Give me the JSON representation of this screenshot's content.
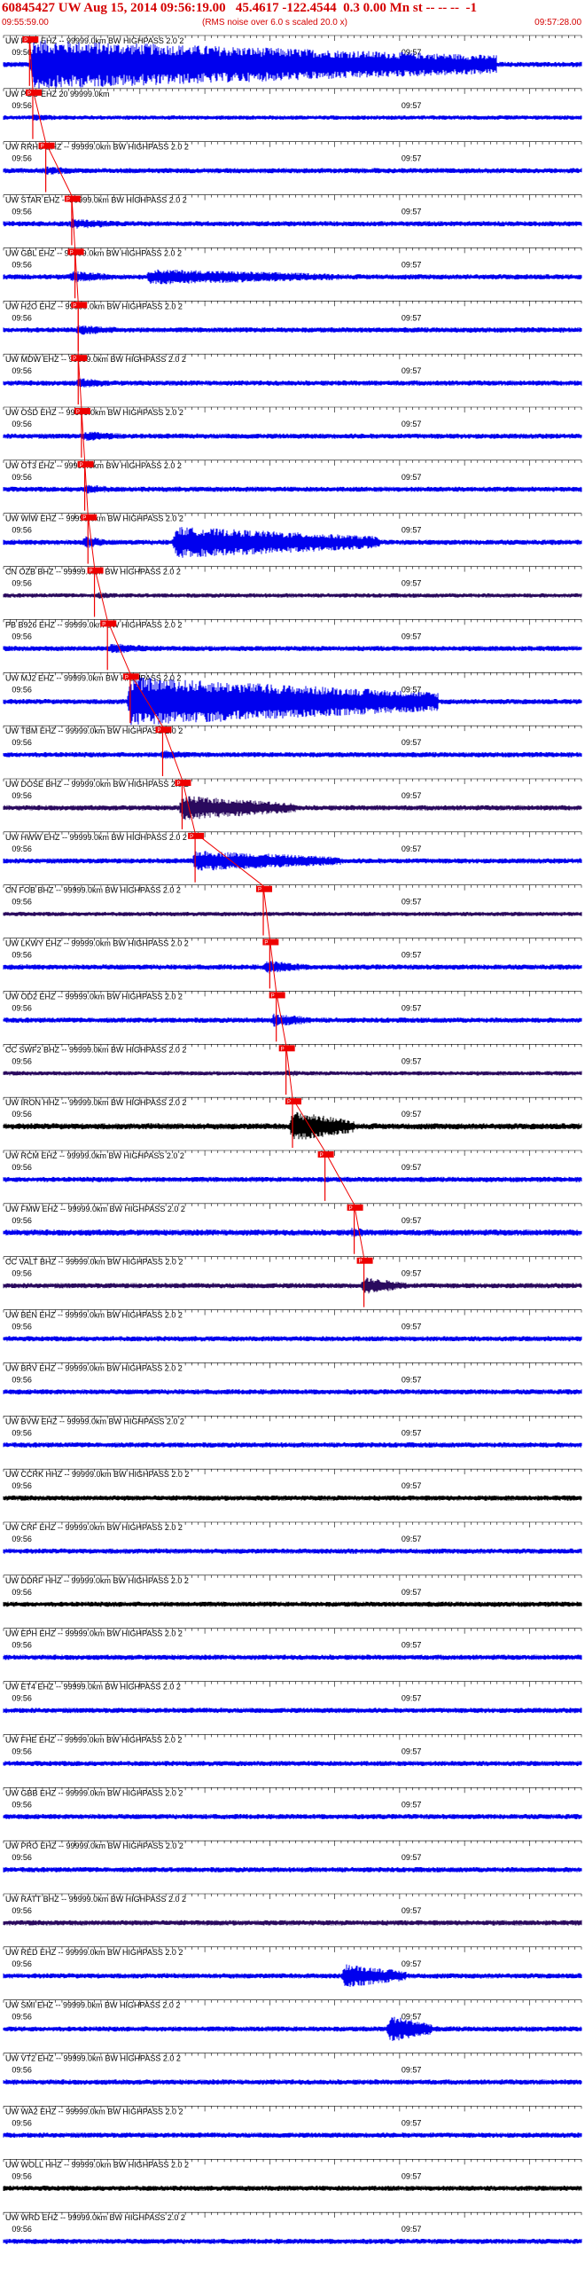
{
  "header": {
    "title": "60845427 UW Aug 15, 2014 09:56:19.00   45.4617 -122.4544  0.3 0.00 Mn st -- -- --  -1",
    "start_time": "09:55:59.00",
    "subtitle": "(RMS noise over 6.0 s scaled 20.0 x)",
    "end_time": "09:57:28.00"
  },
  "colors": {
    "trace_blue": "#0000ee",
    "trace_black": "#000000",
    "trace_purple": "#2a0a5e",
    "pick_red": "#ee0000",
    "header_red": "#d40000",
    "axis": "#000000"
  },
  "chart_data": {
    "type": "line",
    "title": "60845427 UW Aug 15, 2014 09:56:19.00   45.4617 -122.4544  0.3 0.00 Mn st -- -- --  -1",
    "x_range": [
      "09:55:59.00",
      "09:57:28.00"
    ],
    "x_range_seconds": [
      0,
      89
    ],
    "minute_tick_labels": [
      "09:56",
      "09:57"
    ],
    "minute_tick_seconds": [
      1,
      61
    ],
    "traces": [
      {
        "label": "UW PGO EHZ -- 99999.0km BW  HIGHPASS  2.0  2",
        "color": "blue",
        "amp": 3,
        "event": [
          [
            4,
            76,
            28
          ]
        ],
        "pick": 4,
        "pick_label": "P"
      },
      {
        "label": "UW PGO EHZ 20 99999.0km",
        "color": "blue",
        "amp": 2.5,
        "event": [
          [
            4,
            12,
            4
          ]
        ],
        "pick": 4.5,
        "pick_label": "P"
      },
      {
        "label": "UW RRHS EHZ -- 99999.0km BW  HIGHPASS  2.0  2",
        "color": "blue",
        "amp": 3,
        "event": [
          [
            6,
            14,
            5
          ]
        ],
        "pick": 6.5,
        "pick_label": "P"
      },
      {
        "label": "UW STAR EHZ -- 99999.0km BW  HIGHPASS  2.0  2",
        "color": "blue",
        "amp": 3,
        "event": [
          [
            10,
            20,
            6
          ]
        ],
        "pick": 10.5,
        "pick_label": "P"
      },
      {
        "label": "UW GBL EHZ -- 99999.0km BW  HIGHPASS  2.0  2",
        "color": "blue",
        "amp": 3,
        "event": [
          [
            10,
            18,
            7
          ],
          [
            22,
            52,
            9
          ]
        ],
        "pick": 11,
        "pick_label": "P"
      },
      {
        "label": "UW H2O EHZ -- 99999.0km BW  HIGHPASS  2.0  2",
        "color": "blue",
        "amp": 3,
        "event": [
          [
            11,
            20,
            6
          ]
        ],
        "pick": 11.5,
        "pick_label": "P"
      },
      {
        "label": "UW MDW EHZ -- 99999.0km BW  HIGHPASS  2.0  2",
        "color": "blue",
        "amp": 3,
        "event": [
          [
            11,
            18,
            6
          ]
        ],
        "pick": 11.5,
        "pick_label": "P"
      },
      {
        "label": "UW OSD EHZ -- 99999.0km BW  HIGHPASS  2.0  2",
        "color": "blue",
        "amp": 3,
        "event": [
          [
            12,
            20,
            6
          ]
        ],
        "pick": 12,
        "pick_label": "P"
      },
      {
        "label": "UW OT3 EHZ -- 99999.0km BW  HIGHPASS  2.0  2",
        "color": "blue",
        "amp": 3,
        "event": [
          [
            12,
            18,
            6
          ]
        ],
        "pick": 12.5,
        "pick_label": "P"
      },
      {
        "label": "UW WIW EHZ -- 99999.0km BW  HIGHPASS  2.0  2",
        "color": "blue",
        "amp": 3,
        "event": [
          [
            12,
            16,
            8
          ],
          [
            26,
            58,
            18
          ]
        ],
        "pick": 13,
        "pick_label": "P"
      },
      {
        "label": "CN OZB BHZ -- 99999.0km BW  HIGHPASS  2.0  2",
        "color": "purple",
        "amp": 2.5,
        "event": [
          [
            14,
            20,
            4
          ]
        ],
        "pick": 14,
        "pick_label": "P"
      },
      {
        "label": "PB B926 EHZ -- 99999.0km BW  HIGHPASS  2.0  2",
        "color": "blue",
        "amp": 3,
        "event": [
          [
            16,
            26,
            6
          ]
        ],
        "pick": 16,
        "pick_label": "P"
      },
      {
        "label": "UW MJ2 EHZ -- 99999.0km BW  HIGHPASS  2.0  2",
        "color": "blue",
        "amp": 3,
        "event": [
          [
            19,
            67,
            28
          ]
        ],
        "pick": 19.5,
        "pick_label": "P"
      },
      {
        "label": "UW TBM EHZ -- 99999.0km BW  HIGHPASS  2.0  2",
        "color": "blue",
        "amp": 3,
        "event": [
          [
            24,
            30,
            6
          ]
        ],
        "pick": 24.5,
        "pick_label": "P"
      },
      {
        "label": "UW DOSE BHZ -- 99999.0km BW  HIGHPASS  2.0  2",
        "color": "purple",
        "amp": 3,
        "event": [
          [
            27,
            45,
            14
          ]
        ],
        "pick": 27.5,
        "pick_label": "P"
      },
      {
        "label": "UW HWW EHZ -- 99999.0km BW  HIGHPASS  2.0  2",
        "color": "blue",
        "amp": 3,
        "event": [
          [
            29,
            52,
            12
          ]
        ],
        "pick": 29.5,
        "pick_label": "P"
      },
      {
        "label": "CN FOB BHZ -- 99999.0km BW  HIGHPASS  2.0  2",
        "color": "purple",
        "amp": 2.5,
        "event": [
          [
            40,
            45,
            3
          ]
        ],
        "pick": 40,
        "pick_label": "P"
      },
      {
        "label": "UW LKWY EHZ -- 99999.0km BW  HIGHPASS  2.0  2",
        "color": "blue",
        "amp": 3,
        "event": [
          [
            40,
            47,
            8
          ]
        ],
        "pick": 41,
        "pick_label": "P"
      },
      {
        "label": "UW OD2 EHZ -- 99999.0km BW  HIGHPASS  2.0  2",
        "color": "blue",
        "amp": 3,
        "event": [
          [
            41,
            48,
            8
          ]
        ],
        "pick": 42,
        "pick_label": "P"
      },
      {
        "label": "CC SWF2 BHZ -- 99999.0km BW  HIGHPASS  2.0  2",
        "color": "purple",
        "amp": 2.5,
        "event": [
          [
            43,
            48,
            4
          ]
        ],
        "pick": 43.5,
        "pick_label": "P"
      },
      {
        "label": "UW IRON HHZ -- 99999.0km BW  HIGHPASS  2.0  2",
        "color": "black",
        "amp": 3.5,
        "event": [
          [
            44,
            54,
            18
          ]
        ],
        "pick": 44.5,
        "pick_label": "P"
      },
      {
        "label": "UW RCM EHZ -- 99999.0km BW  HIGHPASS  2.0  2",
        "color": "blue",
        "amp": 3,
        "event": [
          [
            49,
            53,
            4
          ]
        ],
        "pick": 49.5,
        "pick_label": "P"
      },
      {
        "label": "UW FMW EHZ -- 99999.0km BW  HIGHPASS  2.0  2",
        "color": "blue",
        "amp": 3.5,
        "event": [
          [
            53,
            58,
            6
          ]
        ],
        "pick": 54,
        "pick_label": "P"
      },
      {
        "label": "CC VALT BHZ -- 99999.0km BW  HIGHPASS  2.0  2",
        "color": "purple",
        "amp": 3,
        "event": [
          [
            55,
            62,
            10
          ]
        ],
        "pick": 55.5,
        "pick_label": "P"
      },
      {
        "label": "UW BEN EHZ -- 99999.0km BW  HIGHPASS  2.0  2",
        "color": "blue",
        "amp": 3,
        "event": [],
        "pick": null,
        "pick_label": ""
      },
      {
        "label": "UW BRV EHZ -- 99999.0km BW  HIGHPASS  2.0  2",
        "color": "blue",
        "amp": 3,
        "event": [],
        "pick": null,
        "pick_label": ""
      },
      {
        "label": "UW BVW EHZ -- 99999.0km BW  HIGHPASS  2.0  2",
        "color": "blue",
        "amp": 3,
        "event": [],
        "pick": null,
        "pick_label": ""
      },
      {
        "label": "UW CCRK HHZ -- 99999.0km BW  HIGHPASS  2.0  2",
        "color": "black",
        "amp": 3,
        "event": [],
        "pick": null,
        "pick_label": ""
      },
      {
        "label": "UW CRF EHZ -- 99999.0km BW  HIGHPASS  2.0  2",
        "color": "blue",
        "amp": 3,
        "event": [],
        "pick": null,
        "pick_label": ""
      },
      {
        "label": "UW DDRF HHZ -- 99999.0km BW  HIGHPASS  2.0  2",
        "color": "black",
        "amp": 3,
        "event": [],
        "pick": null,
        "pick_label": ""
      },
      {
        "label": "UW EPH EHZ -- 99999.0km BW  HIGHPASS  2.0  2",
        "color": "blue",
        "amp": 3,
        "event": [],
        "pick": null,
        "pick_label": ""
      },
      {
        "label": "UW ET4 EHZ -- 99999.0km BW  HIGHPASS  2.0  2",
        "color": "blue",
        "amp": 3,
        "event": [],
        "pick": null,
        "pick_label": ""
      },
      {
        "label": "UW FHE EHZ -- 99999.0km BW  HIGHPASS  2.0  2",
        "color": "blue",
        "amp": 3,
        "event": [],
        "pick": null,
        "pick_label": ""
      },
      {
        "label": "UW GBB EHZ -- 99999.0km BW  HIGHPASS  2.0  2",
        "color": "blue",
        "amp": 3,
        "event": [
          [
            14,
            16,
            4
          ]
        ],
        "pick": null,
        "pick_label": ""
      },
      {
        "label": "UW PRO EHZ -- 99999.0km BW  HIGHPASS  2.0  2",
        "color": "blue",
        "amp": 3,
        "event": [],
        "pick": null,
        "pick_label": ""
      },
      {
        "label": "UW RATT BHZ -- 99999.0km BW  HIGHPASS  2.0  2",
        "color": "purple",
        "amp": 3,
        "event": [],
        "pick": null,
        "pick_label": ""
      },
      {
        "label": "UW RED EHZ -- 99999.0km BW  HIGHPASS  2.0  2",
        "color": "blue",
        "amp": 3,
        "event": [
          [
            14,
            16,
            4
          ],
          [
            52,
            62,
            14
          ]
        ],
        "pick": null,
        "pick_label": ""
      },
      {
        "label": "UW SMI EHZ -- 99999.0km BW  HIGHPASS  2.0  2",
        "color": "blue",
        "amp": 3,
        "event": [
          [
            59,
            66,
            16
          ]
        ],
        "pick": null,
        "pick_label": ""
      },
      {
        "label": "UW VT2 EHZ -- 99999.0km BW  HIGHPASS  2.0  2",
        "color": "blue",
        "amp": 3,
        "event": [],
        "pick": null,
        "pick_label": ""
      },
      {
        "label": "UW WA2 EHZ -- 99999.0km BW  HIGHPASS  2.0  2",
        "color": "blue",
        "amp": 3,
        "event": [],
        "pick": null,
        "pick_label": ""
      },
      {
        "label": "UW WOLL HHZ -- 99999.0km BW  HIGHPASS  2.0  2",
        "color": "black",
        "amp": 3,
        "event": [],
        "pick": null,
        "pick_label": ""
      },
      {
        "label": "UW WRD EHZ -- 99999.0km BW  HIGHPASS  2.0  2",
        "color": "blue",
        "amp": 3,
        "event": [],
        "pick": null,
        "pick_label": ""
      }
    ]
  }
}
